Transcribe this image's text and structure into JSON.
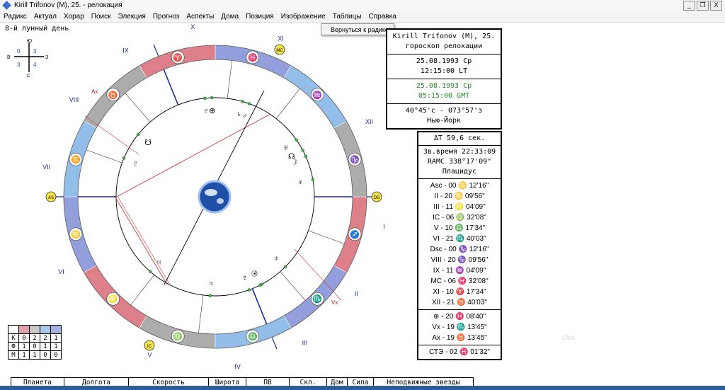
{
  "window": {
    "title": "Kirill Trifonov (M), 25. - релокация",
    "min_glyph": "_",
    "max_glyph": "❐",
    "close_glyph": "X"
  },
  "menu": [
    "Радикс",
    "Актуал",
    "Хорар",
    "Поиск",
    "Элекция",
    "Прогноз",
    "Аспекты",
    "Дома",
    "Позиция",
    "Изображение",
    "Таблицы",
    "Справка"
  ],
  "popup": {
    "label": "Вернуться к радиксу"
  },
  "lunar_day": "8-й лунный день",
  "compass": {
    "north": "Ю",
    "south": "С",
    "west": "В",
    "east": "З",
    "q1": "3",
    "q2": "0",
    "q3": "3",
    "q4": "4"
  },
  "info_box": {
    "title_line1": "Kirill Trifonov (M), 25.",
    "title_line2": "гороскоп релокации",
    "local_date": "25.08.1993 Ср",
    "local_time": "12:15:00 LT",
    "gmt_date": "25.08.1993 Ср",
    "gmt_time": "05:15:00 GMT",
    "coords": "40°45'с - 073°57'з",
    "city": "Нью-Йорк"
  },
  "cusps_box": {
    "delta_t": "ΔT  59,6 сек.",
    "sidereal": "Зв.время 22:33:09",
    "ramc": "RAMC 338°17'09\"",
    "system": "Плацидус",
    "cusps": [
      "Asc - 00 ♋ 12'16\"",
      "II - 20 ♋ 09'56\"",
      "III - 11 ♌ 04'09\"",
      "IC - 06 ♍ 32'08\"",
      "V - 10 ♎ 17'34\"",
      "VI - 21 ♏ 40'03\"",
      "Dsc - 00 ♑ 12'16\"",
      "VIII - 20 ♑ 09'56\"",
      "IX - 11 ♒ 04'09\"",
      "MC - 06 ♓ 32'08\"",
      "XI - 10 ♈ 17'34\"",
      "XII - 21 ♉ 40'03\""
    ],
    "extra": [
      "⊕ - 20 ♓ 08'40\"",
      "Vx - 19 ♏ 13'45\"",
      "Ax - 19 ♉ 13'45\""
    ],
    "ste": "СТЭ - 02 ♓ 01'32\""
  },
  "wheel": {
    "house_numerals": [
      "I",
      "II",
      "III",
      "IV",
      "V",
      "VI",
      "VII",
      "VIII",
      "IX",
      "X",
      "XI",
      "XII"
    ],
    "axis_markers": {
      "asc": "AS",
      "dsc": "DS",
      "mc": "MC",
      "ic": "IC"
    },
    "signs": [
      "♈",
      "♉",
      "♊",
      "♋",
      "♌",
      "♍",
      "♎",
      "♏",
      "♐",
      "♑",
      "♒",
      "♓"
    ],
    "planets": [
      "⊕",
      "♇",
      "♄",
      "♂",
      "☊",
      "☽",
      "♆",
      "♅",
      "☿",
      "♀",
      "☉",
      "♃",
      "♆",
      "☋",
      "♇",
      "♃"
    ],
    "labels": {
      "ax": "Ax",
      "vx": "Vx"
    },
    "colors": {
      "fire": "#d96b75",
      "earth": "#9e9e9e",
      "air": "#7fb3e6",
      "water": "#7f8fd6"
    }
  },
  "elements_table": {
    "rows": [
      {
        "label": "К",
        "values": [
          "0",
          "2",
          "2",
          "1"
        ]
      },
      {
        "label": "Ф",
        "values": [
          "1",
          "0",
          "1",
          "1"
        ]
      },
      {
        "label": "М",
        "values": [
          "1",
          "1",
          "0",
          "0"
        ]
      }
    ],
    "header_colors": [
      "#e0a0a8",
      "#c8c8c8",
      "#a8c8e8",
      "#a8b0e0"
    ]
  },
  "bottom_table": {
    "headers": [
      "Планета",
      "Долгота",
      "Скорость",
      "Широта",
      "ПВ",
      "Скл.",
      "Дом",
      "Сила",
      "Неподвижные звезды"
    ]
  },
  "watermark": "Okis"
}
